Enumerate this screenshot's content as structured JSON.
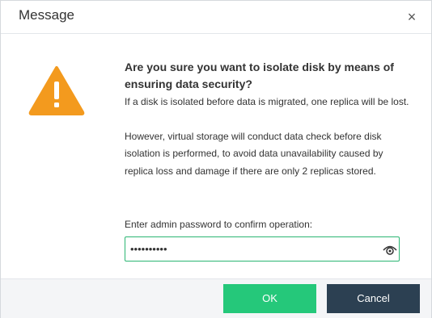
{
  "dialog": {
    "title": "Message",
    "close_symbol": "×",
    "icon": "warning-triangle-icon",
    "heading": "Are you sure you want to isolate disk by means of ensuring data security?",
    "paragraph1": "If a disk is isolated before data is migrated, one replica will be lost.",
    "paragraph2": "However, virtual storage will conduct data check before disk isolation is performed, to avoid data unavailability caused by replica loss and damage if there are only 2 replicas stored.",
    "password_label": "Enter admin password to confirm operation:",
    "password_value": "••••••••••",
    "ok_label": "OK",
    "cancel_label": "Cancel"
  },
  "colors": {
    "warning": "#f39a1e",
    "ok_button": "#25c87a",
    "cancel_button": "#2c4052",
    "input_border": "#2bb673"
  }
}
